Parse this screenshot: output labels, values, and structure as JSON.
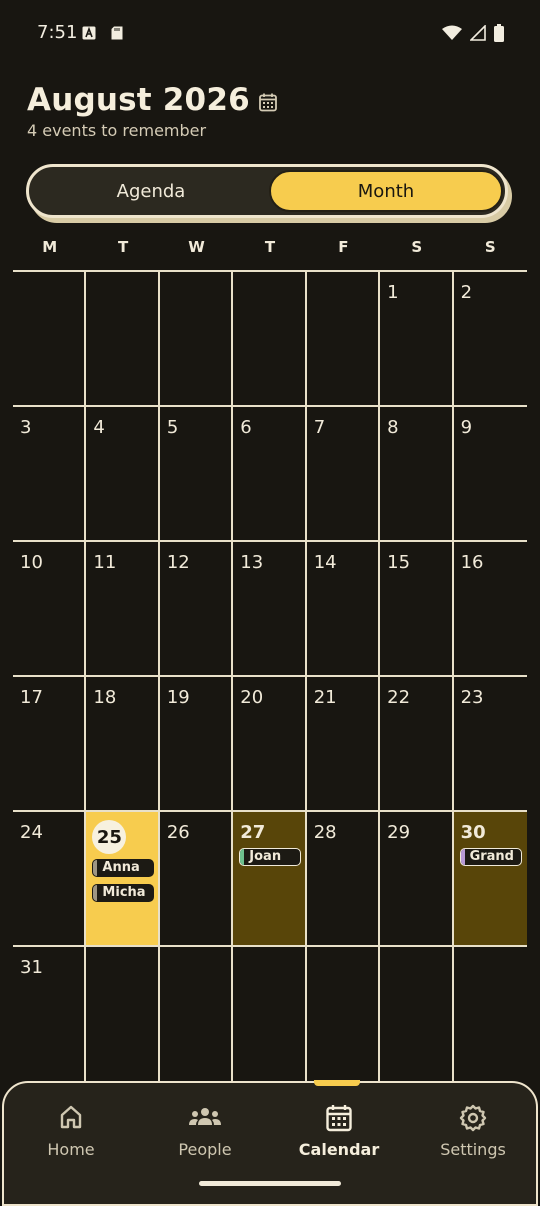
{
  "status": {
    "time": "7:51"
  },
  "header": {
    "title": "August 2026",
    "subtitle": "4 events to remember"
  },
  "view_toggle": {
    "agenda_label": "Agenda",
    "month_label": "Month",
    "selected": "Month"
  },
  "weekdays": [
    "M",
    "T",
    "W",
    "T",
    "F",
    "S",
    "S"
  ],
  "calendar": {
    "days": [
      "",
      "",
      "",
      "",
      "",
      "1",
      "2",
      "3",
      "4",
      "5",
      "6",
      "7",
      "8",
      "9",
      "10",
      "11",
      "12",
      "13",
      "14",
      "15",
      "16",
      "17",
      "18",
      "19",
      "20",
      "21",
      "22",
      "23",
      "24",
      "25",
      "26",
      "27",
      "28",
      "29",
      "30",
      "31",
      "",
      "",
      "",
      "",
      "",
      ""
    ],
    "today": "25",
    "events": [
      {
        "day": "25",
        "label": "Anna",
        "color": "#9e9684"
      },
      {
        "day": "25",
        "label": "Micha",
        "color": "#9e9684"
      },
      {
        "day": "27",
        "label": "Joan",
        "color": "#6ec08d"
      },
      {
        "day": "30",
        "label": "Grand",
        "color": "#b99ad6"
      }
    ],
    "highlighted_days": [
      "27",
      "30"
    ]
  },
  "colors": {
    "accent": "#f7cc4e",
    "background": "#181611",
    "highlight": "#584509",
    "line": "#e8e0c9"
  },
  "nav": {
    "items": [
      {
        "label": "Home",
        "icon": "home-icon"
      },
      {
        "label": "People",
        "icon": "people-icon"
      },
      {
        "label": "Calendar",
        "icon": "calendar-icon",
        "active": true
      },
      {
        "label": "Settings",
        "icon": "gear-icon"
      }
    ]
  }
}
